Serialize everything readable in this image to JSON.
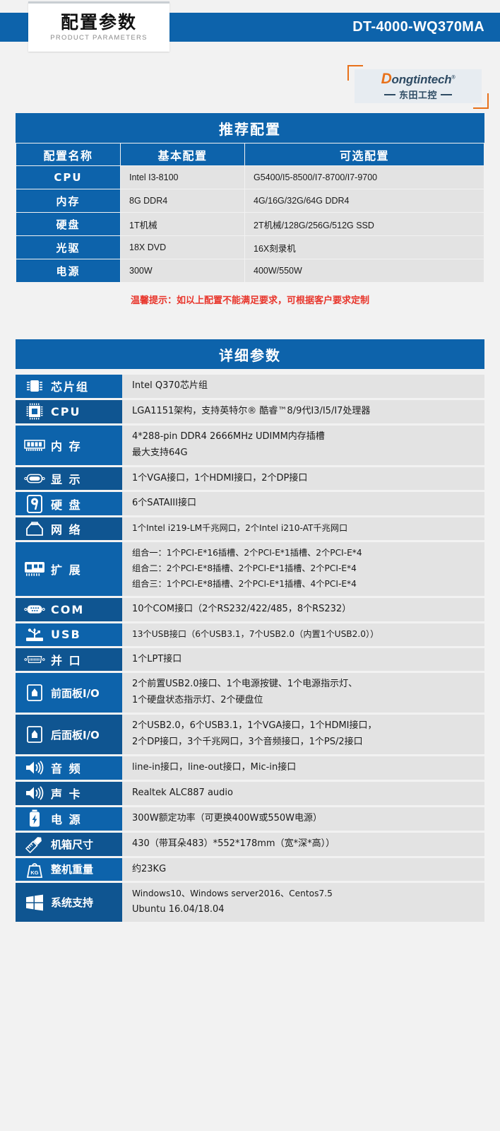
{
  "header": {
    "title_cn": "配置参数",
    "title_en": "PRODUCT PARAMETERS",
    "model": "DT-4000-WQ370MA",
    "logo": {
      "brand_initial": "D",
      "brand_rest": "ongtintech",
      "registered": "®",
      "brand_cn": "东田工控"
    },
    "accent_blue": "#0d63ab",
    "accent_orange": "#e8711a"
  },
  "recommended": {
    "section_title": "推荐配置",
    "columns": [
      "配置名称",
      "基本配置",
      "可选配置"
    ],
    "rows": [
      {
        "name": "CPU",
        "basic": "Intel I3-8100",
        "optional": "G5400/I5-8500/I7-8700/I7-9700"
      },
      {
        "name": "内存",
        "basic": "8G DDR4",
        "optional": "4G/16G/32G/64G DDR4"
      },
      {
        "name": "硬盘",
        "basic": "1T机械",
        "optional": "2T机械/128G/256G/512G SSD"
      },
      {
        "name": "光驱",
        "basic": "18X DVD",
        "optional": "16X刻录机"
      },
      {
        "name": "电源",
        "basic": "300W",
        "optional": "400W/550W"
      }
    ],
    "notice": "温馨提示：如以上配置不能满足要求，可根据客户要求定制",
    "notice_color": "#e8352b"
  },
  "detail": {
    "section_title": "详细参数",
    "rows": [
      {
        "icon": "chipset-icon",
        "name": "芯片组",
        "lines": [
          "Intel Q370芯片组"
        ]
      },
      {
        "icon": "cpu-icon",
        "name": "CPU",
        "lines": [
          "LGA1151架构，支持英特尔® 酷睿™8/9代I3/I5/I7处理器"
        ]
      },
      {
        "icon": "memory-icon",
        "name": "内 存",
        "lines": [
          "4*288-pin DDR4 2666MHz  UDIMM内存插槽",
          "最大支持64G"
        ]
      },
      {
        "icon": "display-icon",
        "name": "显 示",
        "lines": [
          "1个VGA接口，1个HDMI接口，2个DP接口"
        ]
      },
      {
        "icon": "harddisk-icon",
        "name": "硬 盘",
        "lines": [
          "6个SATAIII接口"
        ]
      },
      {
        "icon": "network-icon",
        "name": "网 络",
        "lines": [
          "1个Intel i219-LM千兆网口，2个Intel i210-AT千兆网口"
        ]
      },
      {
        "icon": "expansion-icon",
        "name": "扩 展",
        "lines": [
          "组合一：1个PCI-E*16插槽、2个PCI-E*1插槽、2个PCI-E*4",
          "组合二：2个PCI-E*8插槽、2个PCI-E*1插槽、2个PCI-E*4",
          "组合三：1个PCI-E*8插槽、2个PCI-E*1插槽、4个PCI-E*4"
        ]
      },
      {
        "icon": "com-port-icon",
        "name": "COM",
        "lines": [
          "10个COM接口（2个RS232/422/485，8个RS232）"
        ]
      },
      {
        "icon": "usb-icon",
        "name": "USB",
        "lines": [
          "13个USB接口（6个USB3.1，7个USB2.0（内置1个USB2.0））"
        ]
      },
      {
        "icon": "parallel-port-icon",
        "name": "并 口",
        "lines": [
          "1个LPT接口"
        ]
      },
      {
        "icon": "front-panel-icon",
        "name": "前面板I/O",
        "lines": [
          "2个前置USB2.0接口、1个电源按键、1个电源指示灯、",
          "1个硬盘状态指示灯、2个硬盘位"
        ]
      },
      {
        "icon": "rear-panel-icon",
        "name": "后面板I/O",
        "lines": [
          "2个USB2.0，6个USB3.1，1个VGA接口，1个HDMI接口，",
          "2个DP接口，3个千兆网口，3个音频接口，1个PS/2接口"
        ]
      },
      {
        "icon": "audio-icon",
        "name": "音 频",
        "lines": [
          "line-in接口，line-out接口，Mic-in接口"
        ]
      },
      {
        "icon": "soundcard-icon",
        "name": "声 卡",
        "lines": [
          "Realtek  ALC887 audio"
        ]
      },
      {
        "icon": "power-icon",
        "name": "电 源",
        "lines": [
          "300W额定功率（可更换400W或550W电源）"
        ]
      },
      {
        "icon": "dimension-icon",
        "name": "机箱尺寸",
        "lines": [
          "430（带耳朵483）*552*178mm（宽*深*高））"
        ]
      },
      {
        "icon": "weight-icon",
        "name": "整机重量",
        "lines": [
          "约23KG"
        ]
      },
      {
        "icon": "windows-icon",
        "name": "系统支持",
        "lines": [
          "Windows10、Windows server2016、Centos7.5",
          "Ubuntu 16.04/18.04"
        ]
      }
    ]
  }
}
